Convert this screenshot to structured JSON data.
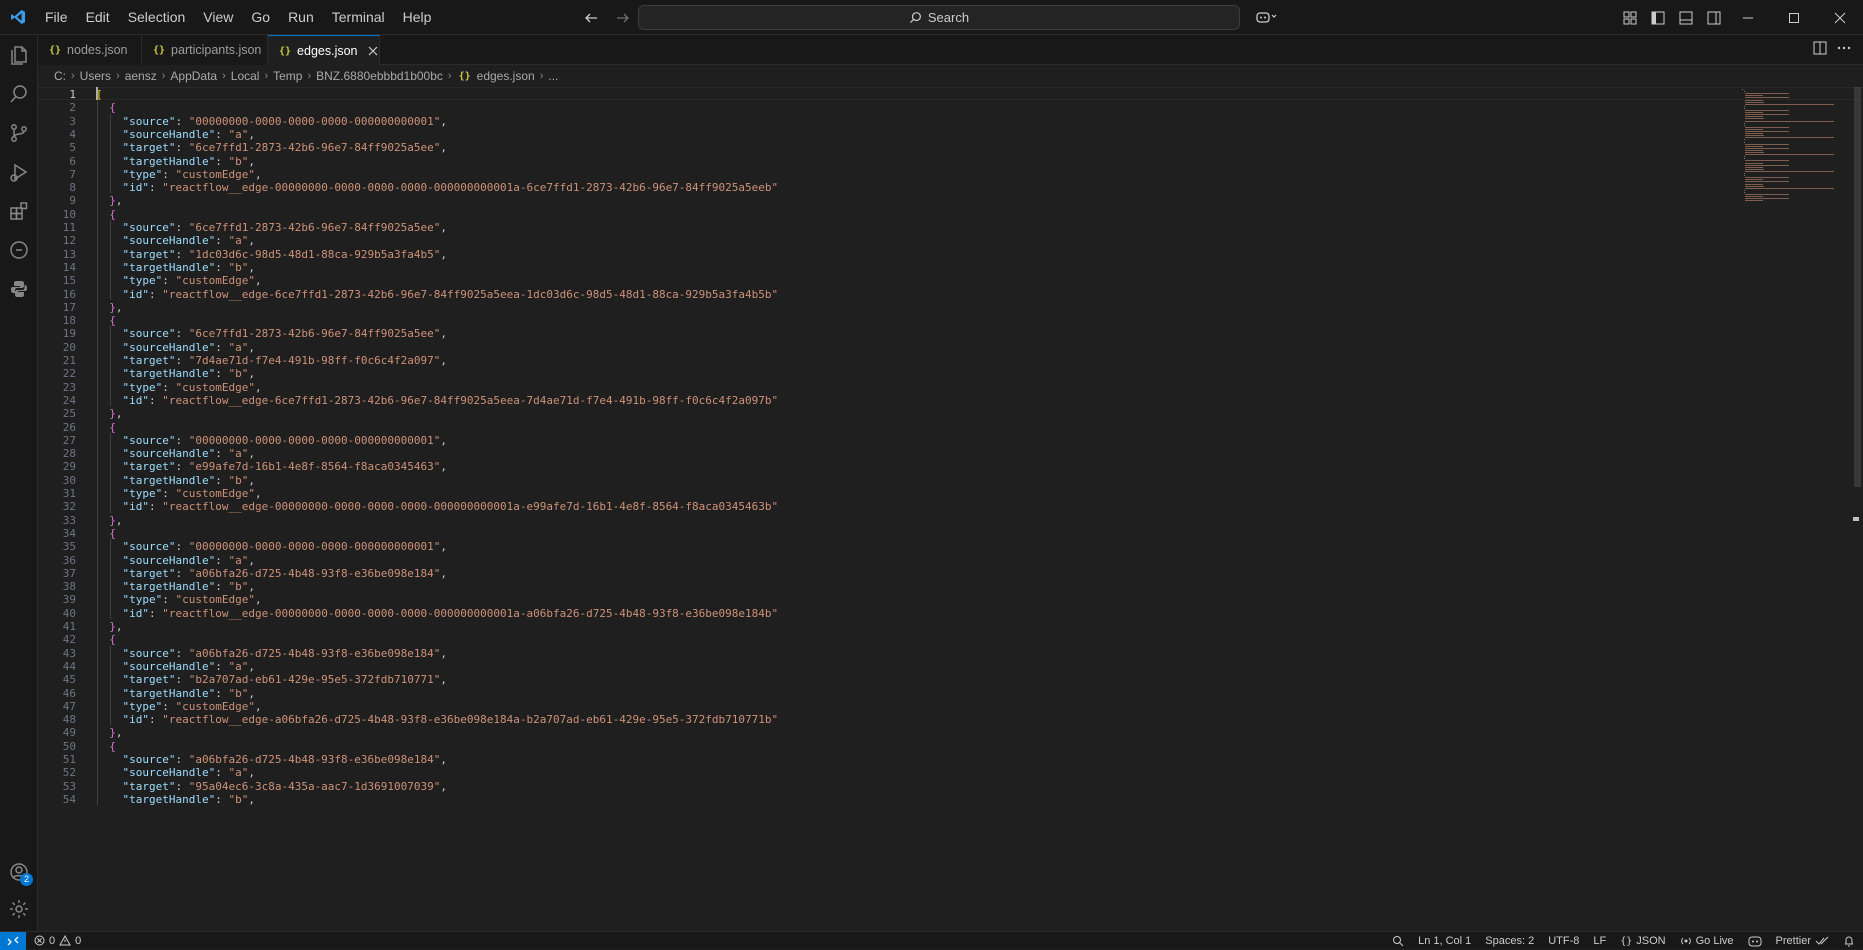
{
  "menu": [
    "File",
    "Edit",
    "Selection",
    "View",
    "Go",
    "Run",
    "Terminal",
    "Help"
  ],
  "search": {
    "label": "Search"
  },
  "tabs": [
    {
      "label": "nodes.json",
      "icon": "json-icon",
      "active": false
    },
    {
      "label": "participants.json",
      "icon": "json-icon",
      "active": false
    },
    {
      "label": "edges.json",
      "icon": "json-icon",
      "active": true
    }
  ],
  "tab_icon_glyph": "{}",
  "breadcrumb": [
    "C:",
    "Users",
    "aensz",
    "AppData",
    "Local",
    "Temp",
    "BNZ.6880ebbbd1b00bc",
    "edges.json",
    "..."
  ],
  "editor": {
    "current_line": 1,
    "lines": [
      "[",
      "  {",
      "    \"source\": \"00000000-0000-0000-0000-000000000001\",",
      "    \"sourceHandle\": \"a\",",
      "    \"target\": \"6ce7ffd1-2873-42b6-96e7-84ff9025a5ee\",",
      "    \"targetHandle\": \"b\",",
      "    \"type\": \"customEdge\",",
      "    \"id\": \"reactflow__edge-00000000-0000-0000-0000-000000000001a-6ce7ffd1-2873-42b6-96e7-84ff9025a5eeb\"",
      "  },",
      "  {",
      "    \"source\": \"6ce7ffd1-2873-42b6-96e7-84ff9025a5ee\",",
      "    \"sourceHandle\": \"a\",",
      "    \"target\": \"1dc03d6c-98d5-48d1-88ca-929b5a3fa4b5\",",
      "    \"targetHandle\": \"b\",",
      "    \"type\": \"customEdge\",",
      "    \"id\": \"reactflow__edge-6ce7ffd1-2873-42b6-96e7-84ff9025a5eea-1dc03d6c-98d5-48d1-88ca-929b5a3fa4b5b\"",
      "  },",
      "  {",
      "    \"source\": \"6ce7ffd1-2873-42b6-96e7-84ff9025a5ee\",",
      "    \"sourceHandle\": \"a\",",
      "    \"target\": \"7d4ae71d-f7e4-491b-98ff-f0c6c4f2a097\",",
      "    \"targetHandle\": \"b\",",
      "    \"type\": \"customEdge\",",
      "    \"id\": \"reactflow__edge-6ce7ffd1-2873-42b6-96e7-84ff9025a5eea-7d4ae71d-f7e4-491b-98ff-f0c6c4f2a097b\"",
      "  },",
      "  {",
      "    \"source\": \"00000000-0000-0000-0000-000000000001\",",
      "    \"sourceHandle\": \"a\",",
      "    \"target\": \"e99afe7d-16b1-4e8f-8564-f8aca0345463\",",
      "    \"targetHandle\": \"b\",",
      "    \"type\": \"customEdge\",",
      "    \"id\": \"reactflow__edge-00000000-0000-0000-0000-000000000001a-e99afe7d-16b1-4e8f-8564-f8aca0345463b\"",
      "  },",
      "  {",
      "    \"source\": \"00000000-0000-0000-0000-000000000001\",",
      "    \"sourceHandle\": \"a\",",
      "    \"target\": \"a06bfa26-d725-4b48-93f8-e36be098e184\",",
      "    \"targetHandle\": \"b\",",
      "    \"type\": \"customEdge\",",
      "    \"id\": \"reactflow__edge-00000000-0000-0000-0000-000000000001a-a06bfa26-d725-4b48-93f8-e36be098e184b\"",
      "  },",
      "  {",
      "    \"source\": \"a06bfa26-d725-4b48-93f8-e36be098e184\",",
      "    \"sourceHandle\": \"a\",",
      "    \"target\": \"b2a707ad-eb61-429e-95e5-372fdb710771\",",
      "    \"targetHandle\": \"b\",",
      "    \"type\": \"customEdge\",",
      "    \"id\": \"reactflow__edge-a06bfa26-d725-4b48-93f8-e36be098e184a-b2a707ad-eb61-429e-95e5-372fdb710771b\"",
      "  },",
      "  {",
      "    \"source\": \"a06bfa26-d725-4b48-93f8-e36be098e184\",",
      "    \"sourceHandle\": \"a\",",
      "    \"target\": \"95a04ec6-3c8a-435a-aac7-1d3691007039\",",
      "    \"targetHandle\": \"b\","
    ]
  },
  "statusbar": {
    "errors": "0",
    "warnings": "0",
    "cursor_position": "Ln 1, Col 1",
    "spaces": "Spaces: 2",
    "encoding": "UTF-8",
    "eol": "LF",
    "language": "JSON",
    "go_live": "Go Live",
    "prettier": "Prettier"
  },
  "accounts_badge": "2",
  "colors": {
    "accent": "#0078d4",
    "key": "#9cdcfe",
    "string": "#ce9178",
    "bracket": "#ffd700",
    "brace": "#da70d6",
    "json_icon": "#cbcb41"
  }
}
